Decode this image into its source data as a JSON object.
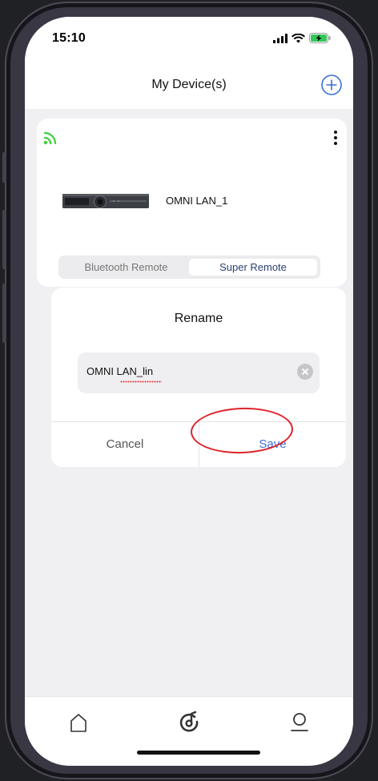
{
  "status_bar": {
    "time": "15:10",
    "icons": [
      "signal-icon",
      "wifi-icon",
      "battery-charging-icon"
    ]
  },
  "header": {
    "title": "My Device(s)",
    "add_icon": "add-circle-icon"
  },
  "device_card": {
    "name": "OMNI LAN_1",
    "connection_icon": "wifi-connected-icon",
    "connection_color": "#3bd13b",
    "menu_icon": "more-vertical-icon",
    "remote_modes": {
      "options": [
        "Bluetooth Remote",
        "Super Remote"
      ],
      "selected": "Super Remote"
    }
  },
  "rename_dialog": {
    "title": "Rename",
    "input_value": "OMNI LAN_lin",
    "cancel_label": "Cancel",
    "save_label": "Save"
  },
  "tab_bar": {
    "tabs": [
      {
        "icon": "home-icon"
      },
      {
        "icon": "music-disc-icon"
      },
      {
        "icon": "profile-icon"
      }
    ]
  },
  "colors": {
    "accent": "#3a6fd8",
    "annotation_ring": "#e0232a",
    "background": "#f0f0f2"
  }
}
